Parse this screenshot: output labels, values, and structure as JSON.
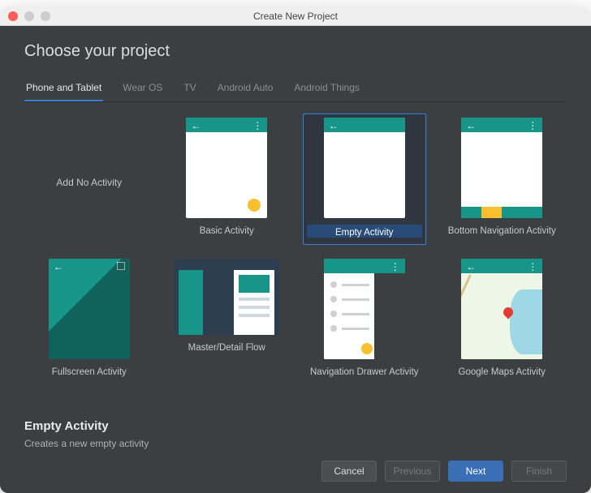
{
  "window": {
    "title": "Create New Project"
  },
  "heading": "Choose your project",
  "tabs": [
    {
      "label": "Phone and Tablet",
      "active": true
    },
    {
      "label": "Wear OS"
    },
    {
      "label": "TV"
    },
    {
      "label": "Android Auto"
    },
    {
      "label": "Android Things"
    }
  ],
  "templates": [
    {
      "label": "Add No Activity"
    },
    {
      "label": "Basic Activity"
    },
    {
      "label": "Empty Activity",
      "selected": true
    },
    {
      "label": "Bottom Navigation Activity"
    },
    {
      "label": "Fullscreen Activity"
    },
    {
      "label": "Master/Detail Flow"
    },
    {
      "label": "Navigation Drawer Activity"
    },
    {
      "label": "Google Maps Activity"
    }
  ],
  "description": {
    "title": "Empty Activity",
    "text": "Creates a new empty activity"
  },
  "buttons": {
    "cancel": "Cancel",
    "previous": "Previous",
    "next": "Next",
    "finish": "Finish"
  },
  "colors": {
    "accent": "#179588",
    "fab": "#f8c02f",
    "primary_button": "#3a6fb6",
    "tab_underline": "#3a7fd6",
    "background": "#3c3f41"
  }
}
